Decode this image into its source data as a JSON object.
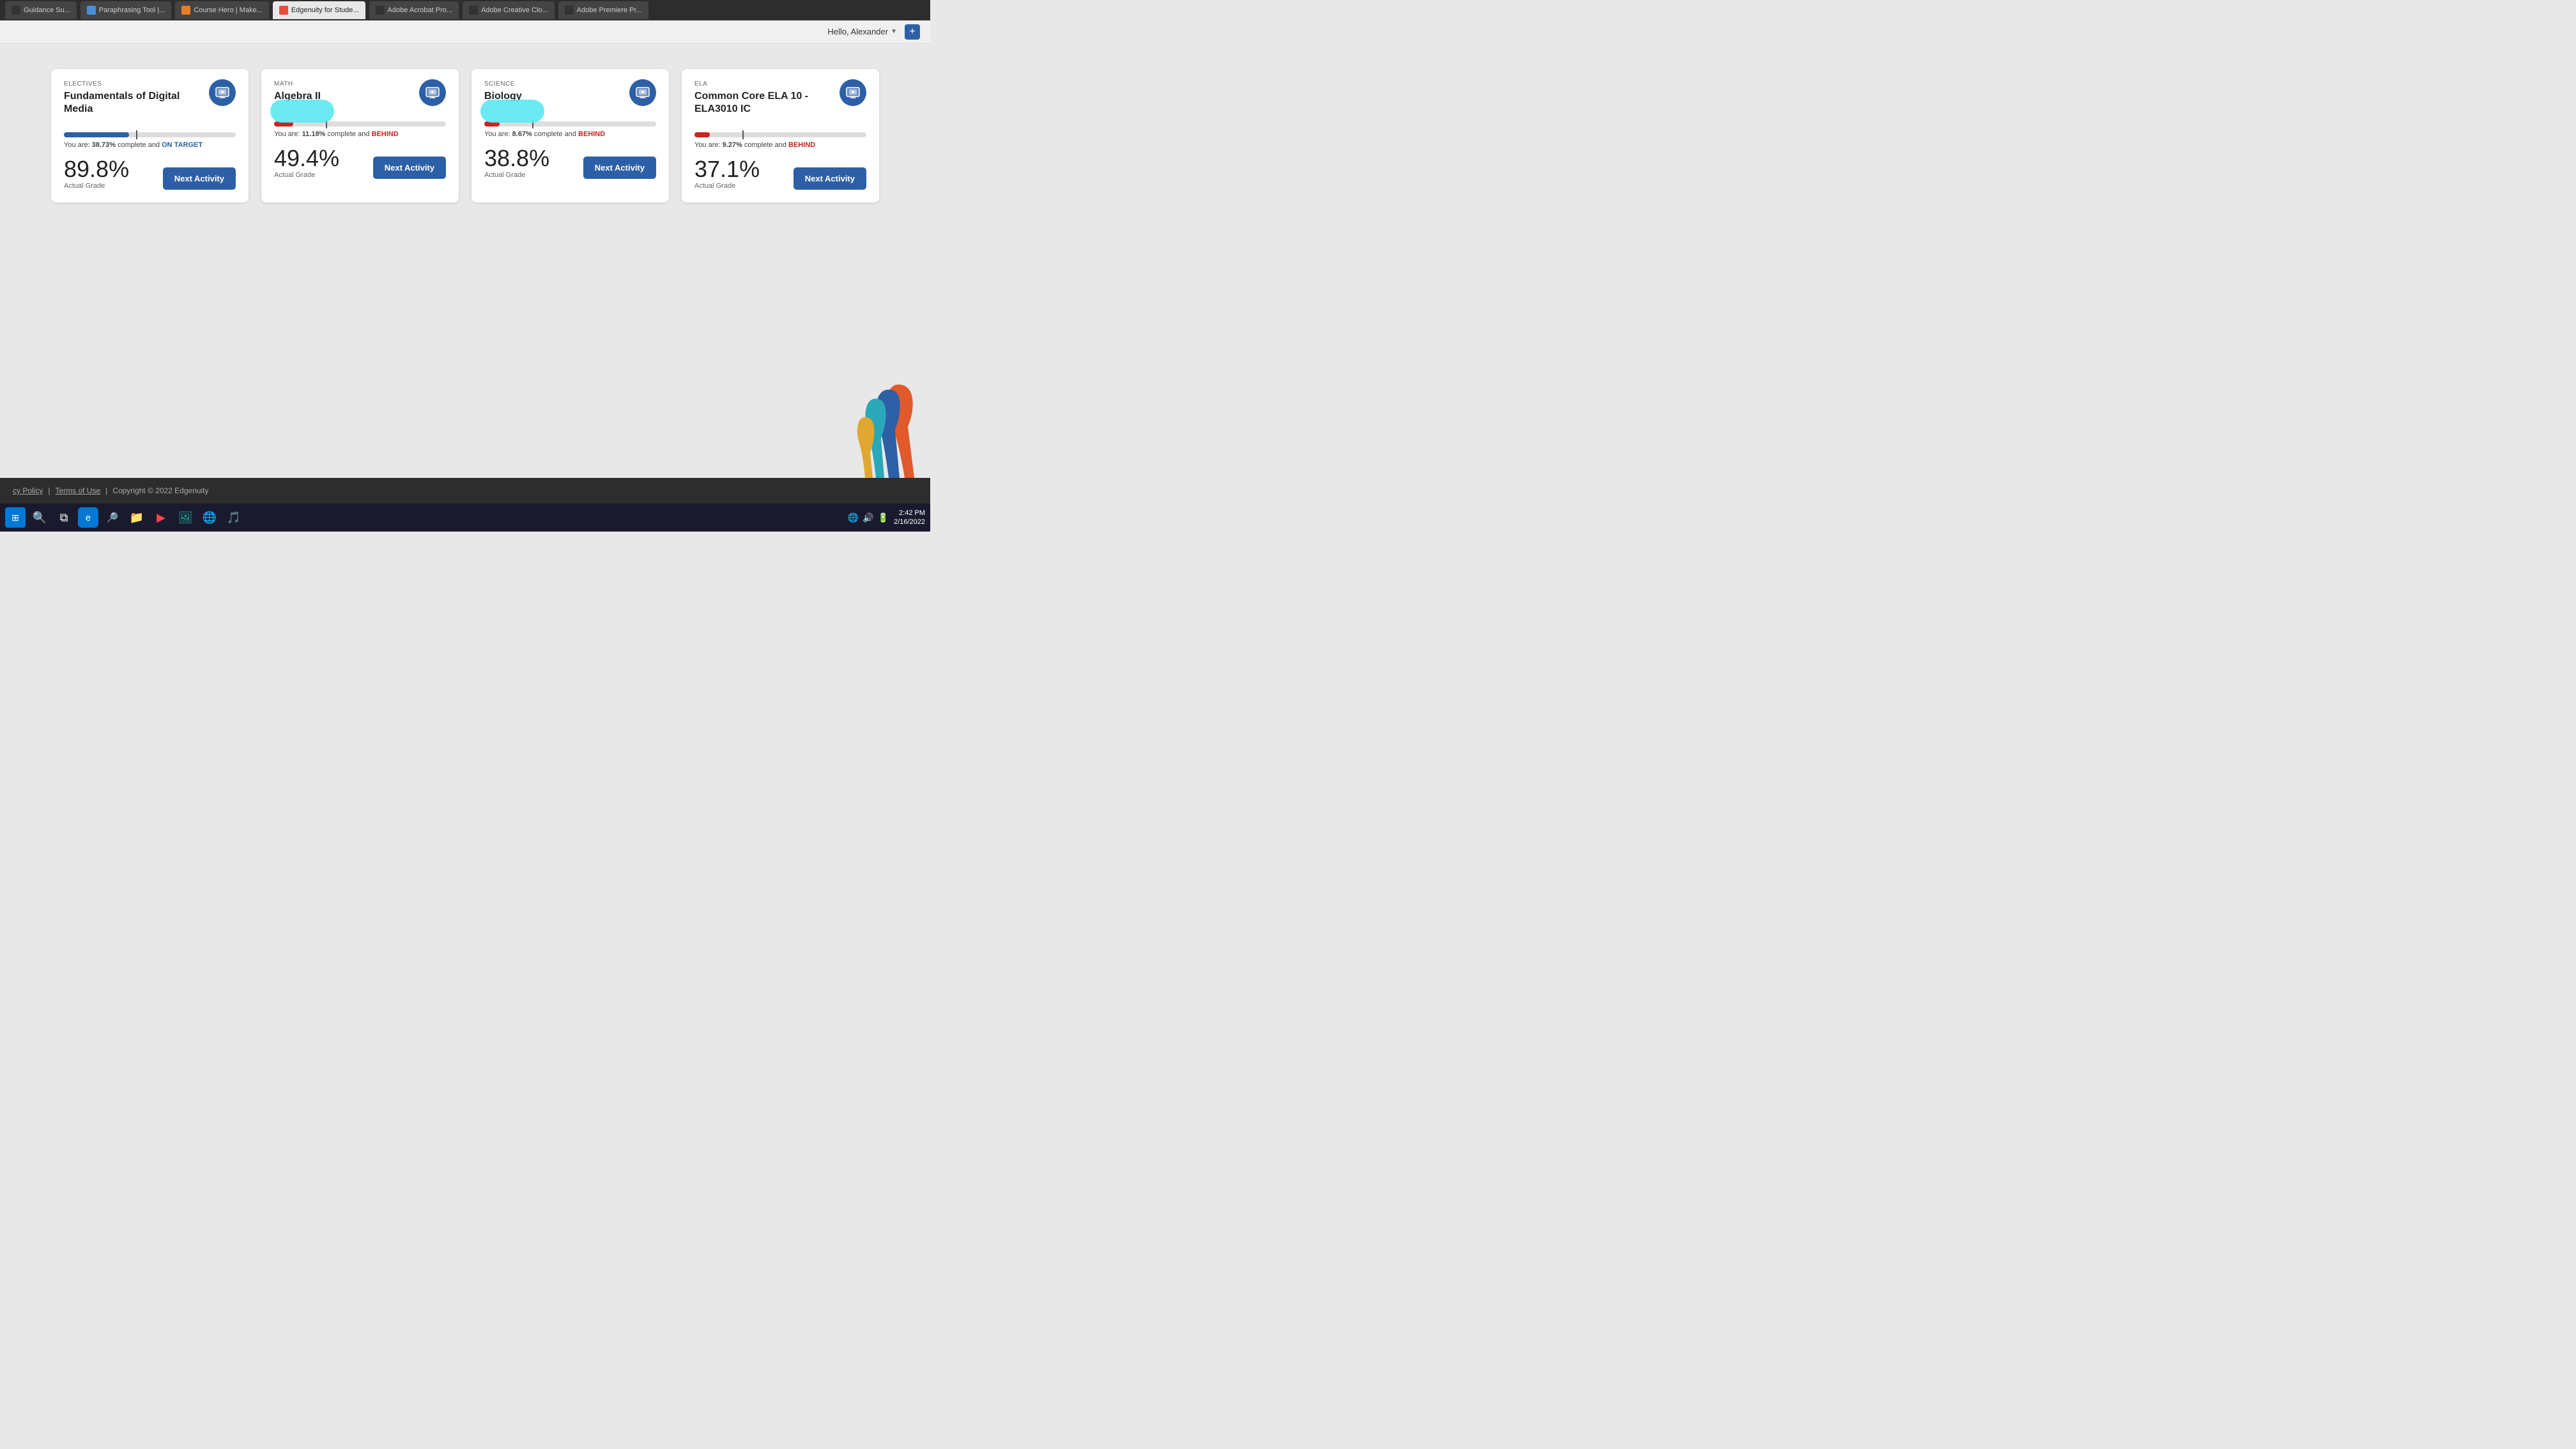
{
  "browser": {
    "tabs": [
      {
        "label": "Guidance Su...",
        "favicon": "dark",
        "active": false
      },
      {
        "label": "Paraphrasing Tool |...",
        "favicon": "blue",
        "active": false
      },
      {
        "label": "Course Hero | Make...",
        "favicon": "orange",
        "active": false
      },
      {
        "label": "Edgenuity for Stude...",
        "favicon": "red",
        "active": true
      },
      {
        "label": "Adobe Acrobat Pro...",
        "favicon": "dark",
        "active": false
      },
      {
        "label": "Adobe Creative Clo...",
        "favicon": "dark",
        "active": false
      },
      {
        "label": "Adobe Premiere Pr...",
        "favicon": "dark",
        "active": false
      }
    ]
  },
  "header": {
    "greeting": "Hello, Alexander",
    "add_label": "+"
  },
  "courses": [
    {
      "subject": "ELECTIVES",
      "title": "Fundamentals of Digital Media",
      "progress_pct": 38.73,
      "progress_fill_pct": 38,
      "marker_pct": 42,
      "status": "ON TARGET",
      "status_type": "ontarget",
      "status_text": "You are: 38.73% complete and ON TARGET",
      "grade": "89.8%",
      "grade_label": "Actual Grade",
      "btn_label": "Next Activity",
      "has_blur": false,
      "progress_color": "blue"
    },
    {
      "subject": "MATH",
      "title": "Algebra II",
      "progress_pct": 11.18,
      "progress_fill_pct": 11,
      "marker_pct": 30,
      "status": "BEHIND",
      "status_type": "behind",
      "status_text": "You are: 11.18% complete and BEHIND",
      "grade": "49.4%",
      "grade_label": "Actual Grade",
      "btn_label": "Next Activity",
      "has_blur": true,
      "progress_color": "red"
    },
    {
      "subject": "SCIENCE",
      "title": "Biology",
      "progress_pct": 8.67,
      "progress_fill_pct": 9,
      "marker_pct": 28,
      "status": "BEHIND",
      "status_type": "behind",
      "status_text": "You are: 8.67% complete and BEHIND",
      "grade": "38.8%",
      "grade_label": "Actual Grade",
      "btn_label": "Next Activity",
      "has_blur": true,
      "progress_color": "red"
    },
    {
      "subject": "ELA",
      "title": "Common Core ELA 10 - ELA3010 IC",
      "progress_pct": 9.27,
      "progress_fill_pct": 9,
      "marker_pct": 28,
      "status": "BEHIND",
      "status_type": "behind",
      "status_text": "You are: 9.27% complete and BEHIND",
      "grade": "37.1%",
      "grade_label": "Actual Grade",
      "btn_label": "Next Activity",
      "has_blur": false,
      "progress_color": "red"
    }
  ],
  "footer": {
    "policy_label": "cy Policy",
    "terms_label": "Terms of Use",
    "copyright": "Copyright © 2022 Edgenuity"
  },
  "taskbar": {
    "time": "2:42 PM",
    "date": "2/16/2022"
  }
}
